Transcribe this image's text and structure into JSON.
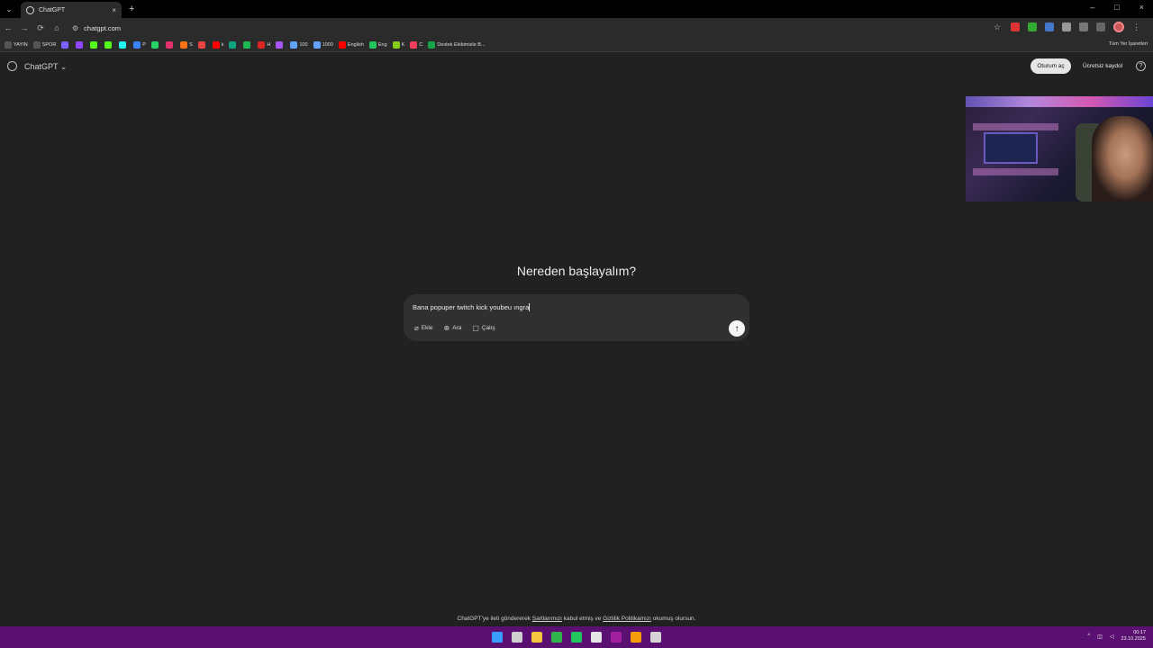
{
  "browser": {
    "tab_title": "ChatGPT",
    "tab_close": "×",
    "new_tab": "+",
    "url": "chatgpt.com",
    "window_controls": [
      "–",
      "□",
      "×"
    ],
    "nav": [
      "←",
      "→",
      "⟳",
      "⌂"
    ]
  },
  "bookmarks": {
    "items": [
      {
        "label": "YAYIN",
        "color": "#555555"
      },
      {
        "label": "SPOR",
        "color": "#555555"
      },
      {
        "label": "",
        "color": "#7b61ff"
      },
      {
        "label": "",
        "color": "#9146ff"
      },
      {
        "label": "",
        "color": "#53fc18"
      },
      {
        "label": "",
        "color": "#53fc18"
      },
      {
        "label": "",
        "color": "#25f4ee"
      },
      {
        "label": "P",
        "color": "#3b82f6"
      },
      {
        "label": "",
        "color": "#25d366"
      },
      {
        "label": "",
        "color": "#e1306c"
      },
      {
        "label": "S",
        "color": "#f97316"
      },
      {
        "label": "",
        "color": "#ef4444"
      },
      {
        "label": "k",
        "color": "#ff0000"
      },
      {
        "label": "",
        "color": "#10a37f"
      },
      {
        "label": "",
        "color": "#1db954"
      },
      {
        "label": "H",
        "color": "#dc2626"
      },
      {
        "label": "",
        "color": "#a855f7"
      },
      {
        "label": "100",
        "color": "#60a5fa"
      },
      {
        "label": "1000",
        "color": "#60a5fa"
      },
      {
        "label": "English",
        "color": "#ff0000"
      },
      {
        "label": "Eng",
        "color": "#22c55e"
      },
      {
        "label": "K",
        "color": "#84cc16"
      },
      {
        "label": "C",
        "color": "#f43f5e"
      },
      {
        "label": "Destek Ekibimizle B...",
        "color": "#16a34a"
      }
    ],
    "all_bookmarks": "Tüm Yer İşaretleri"
  },
  "app": {
    "model_name": "ChatGPT ⌄",
    "login_label": "Oturum aç",
    "signup_label": "Ücretsiz kaydol",
    "help": "?"
  },
  "hero": {
    "title": "Nereden başlayalım?"
  },
  "composer": {
    "input_value": "Bana popuper twitch kick youbeu ıngra",
    "tools": [
      {
        "icon": "⌀",
        "label": "Ekle"
      },
      {
        "icon": "⊕",
        "label": "Ara"
      },
      {
        "icon": "▢",
        "label": "Çalış"
      }
    ],
    "send_icon": "↑"
  },
  "footer": {
    "prefix": "ChatGPT'ye ileti göndererek ",
    "terms": "Şartlarımızı",
    "middle": " kabul etmiş ve ",
    "privacy": "Gizlilik Politikamızı",
    "suffix": " okumuş olursun."
  },
  "taskbar": {
    "icons": [
      {
        "name": "windows-start-icon",
        "color": "#3b9cff"
      },
      {
        "name": "task-view-icon",
        "color": "#cfcfcf"
      },
      {
        "name": "file-explorer-icon",
        "color": "#f5c542"
      },
      {
        "name": "xbox-icon",
        "color": "#2fb34a"
      },
      {
        "name": "media-play-icon",
        "color": "#22c55e"
      },
      {
        "name": "steam-icon",
        "color": "#e5e5e5"
      },
      {
        "name": "app-icon",
        "color": "#a020a0"
      },
      {
        "name": "chrome-icon",
        "color": "#f59e0b"
      },
      {
        "name": "settings-icon",
        "color": "#d4d4d4"
      }
    ],
    "tray_chevron": "^",
    "time": "00:17",
    "date": "23.10.2025"
  }
}
